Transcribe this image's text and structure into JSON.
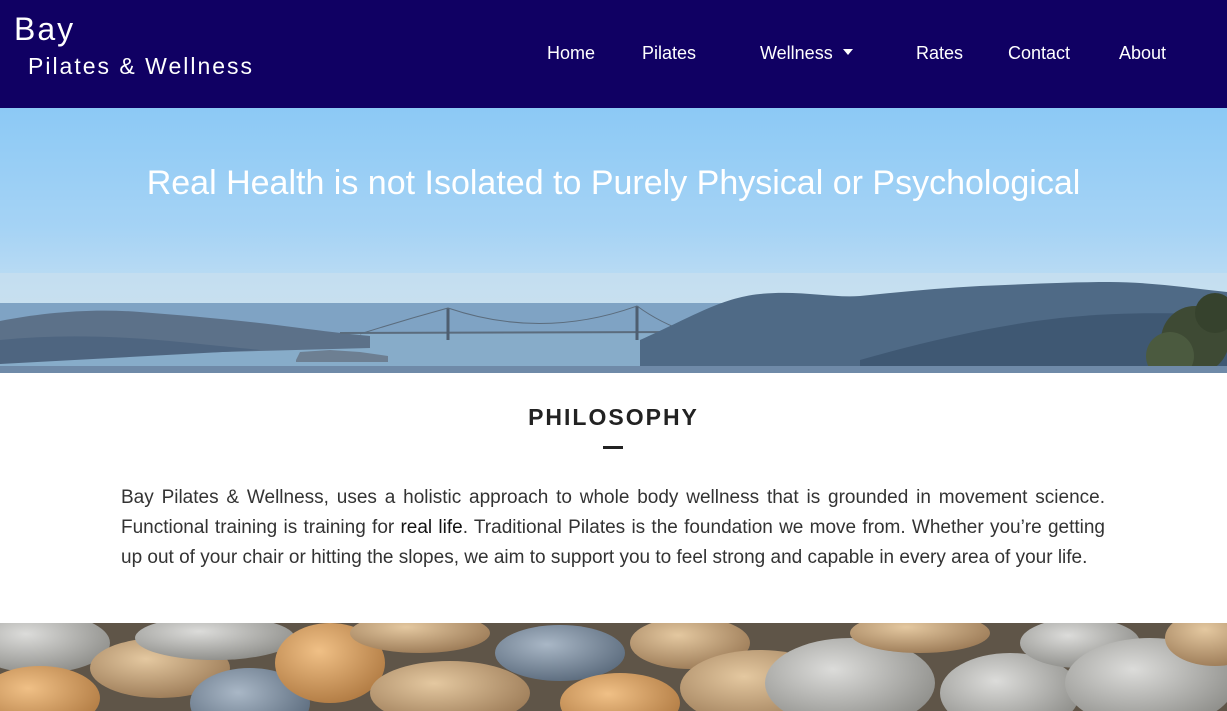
{
  "brand": {
    "line1": "Bay",
    "line2": "Pilates & Wellness"
  },
  "nav": {
    "items": [
      {
        "label": "Home"
      },
      {
        "label": "Pilates"
      },
      {
        "label": "Wellness",
        "dropdown": true
      },
      {
        "label": "Rates"
      },
      {
        "label": "Contact"
      },
      {
        "label": "About"
      }
    ]
  },
  "hero": {
    "title": "Real Health is not Isolated to Purely Physical or Psychological"
  },
  "philosophy": {
    "title": "PHILOSOPHY",
    "text_before": "Bay Pilates & Wellness, uses a holistic approach to whole body wellness that is grounded in movement science. Functional training is training for ",
    "text_bold": "real life",
    "text_after": ". Traditional Pilates is the foundation we move from. Whether you’re getting up out of your chair or hitting the slopes, we aim to support you to feel strong and capable in every area of your life."
  },
  "colors": {
    "navbar": "#100063",
    "text": "#333333",
    "heading": "#222222"
  }
}
